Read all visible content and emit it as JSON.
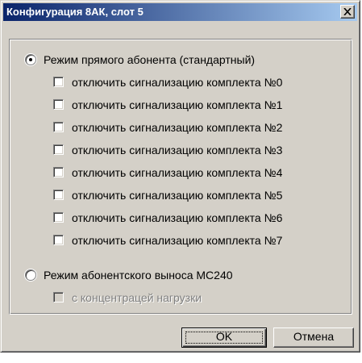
{
  "window": {
    "title": "Конфигурация 8АК, слот 5"
  },
  "modes": {
    "direct": {
      "label": "Режим прямого абонента (стандартный)",
      "selected": true
    },
    "checkboxes": [
      {
        "label": "отключить сигнализацию комплекта №0",
        "checked": false
      },
      {
        "label": "отключить сигнализацию комплекта №1",
        "checked": false
      },
      {
        "label": "отключить сигнализацию комплекта №2",
        "checked": false
      },
      {
        "label": "отключить сигнализацию комплекта №3",
        "checked": false
      },
      {
        "label": "отключить сигнализацию комплекта №4",
        "checked": false
      },
      {
        "label": "отключить сигнализацию комплекта №5",
        "checked": false
      },
      {
        "label": "отключить сигнализацию комплекта №6",
        "checked": false
      },
      {
        "label": "отключить сигнализацию комплекта №7",
        "checked": false
      }
    ],
    "remote": {
      "label": "Режим абонентского выноса МС240",
      "selected": false
    },
    "concentrator": {
      "label": "с концентрацей нагрузки",
      "checked": false,
      "enabled": false
    }
  },
  "buttons": {
    "ok": "OK",
    "cancel": "Отмена"
  },
  "colors": {
    "titlebar_start": "#0a246a",
    "titlebar_end": "#a6caf0",
    "face": "#d4d0c8"
  }
}
